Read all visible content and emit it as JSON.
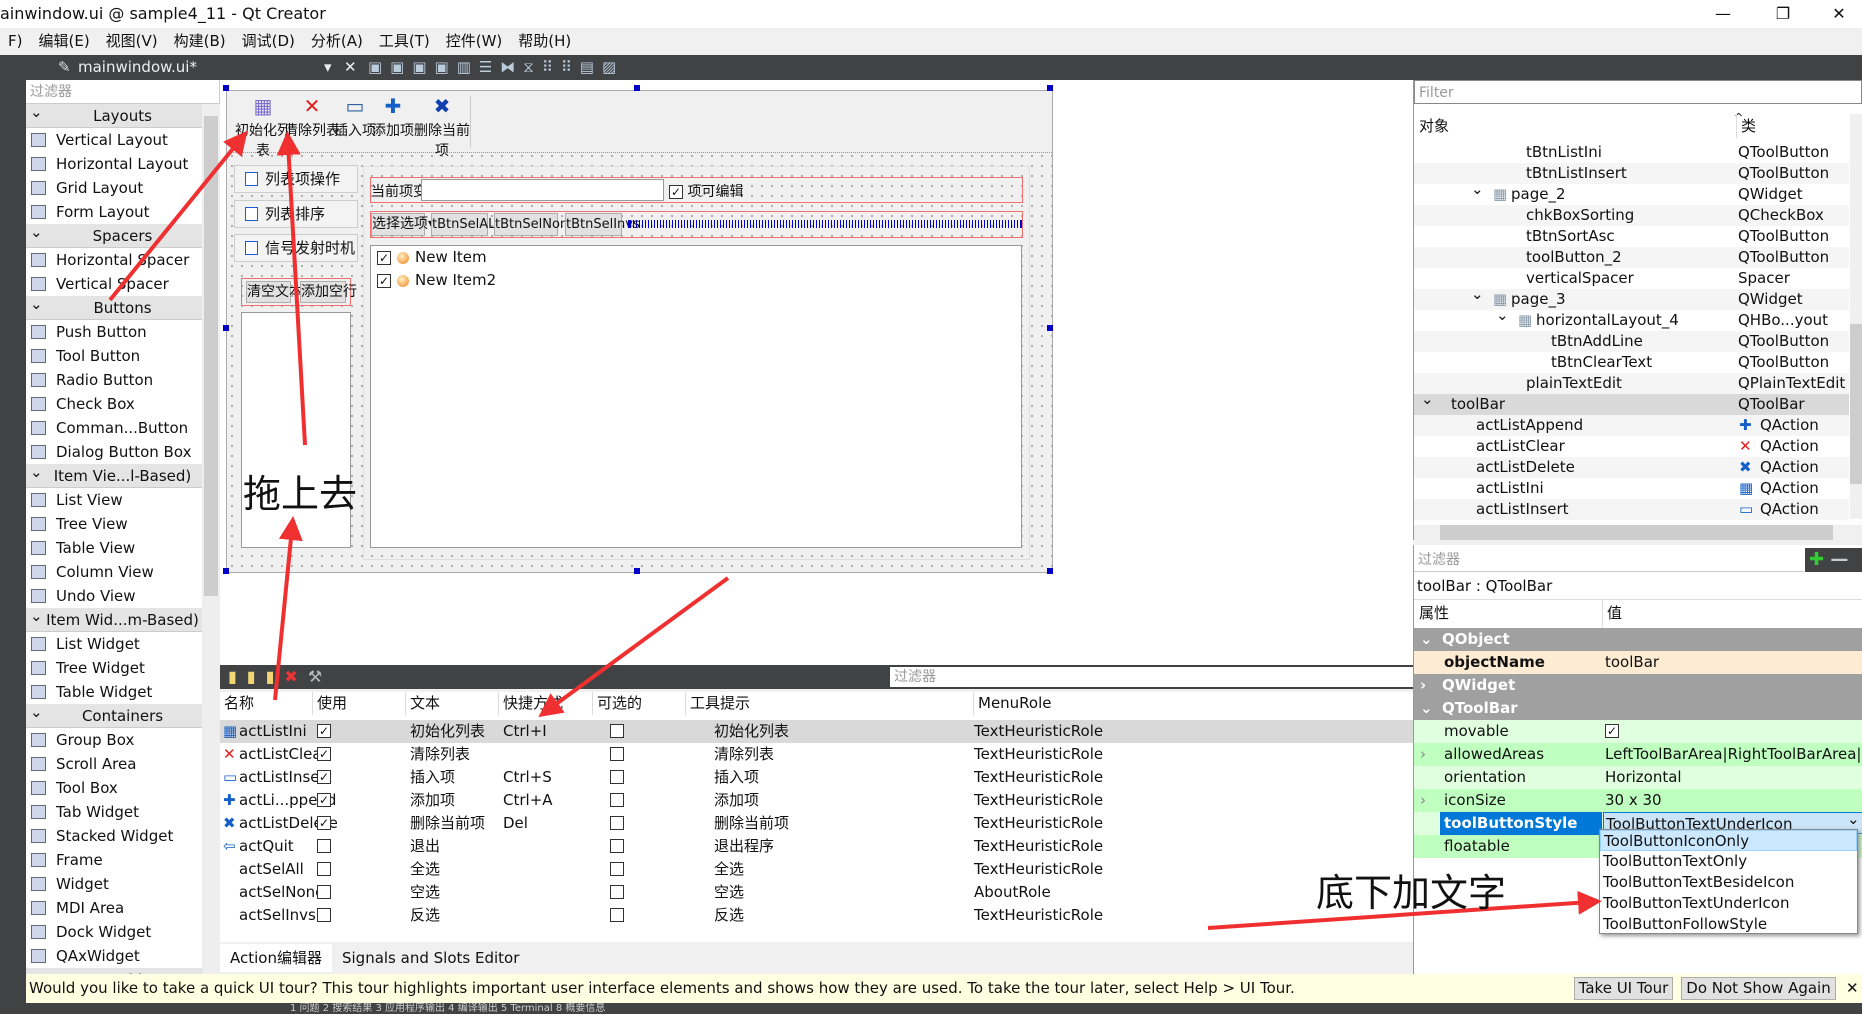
{
  "window": {
    "title": "ainwindow.ui @ sample4_11 - Qt Creator",
    "min": "—",
    "max": "❐",
    "close": "✕"
  },
  "menu": [
    "F)",
    "编辑(E)",
    "视图(V)",
    "构建(B)",
    "调试(D)",
    "分析(A)",
    "工具(T)",
    "控件(W)",
    "帮助(H)"
  ],
  "editor_toolbar": {
    "file": "mainwindow.ui*",
    "close": "✕"
  },
  "widget_box": {
    "filter_placeholder": "过滤器",
    "sections": [
      {
        "title": "Layouts",
        "items": [
          "Vertical Layout",
          "Horizontal Layout",
          "Grid Layout",
          "Form Layout"
        ]
      },
      {
        "title": "Spacers",
        "items": [
          "Horizontal Spacer",
          "Vertical Spacer"
        ]
      },
      {
        "title": "Buttons",
        "items": [
          "Push Button",
          "Tool Button",
          "Radio Button",
          "Check Box",
          "Comman...Button",
          "Dialog Button Box"
        ]
      },
      {
        "title": "Item Vie...l-Based)",
        "items": [
          "List View",
          "Tree View",
          "Table View",
          "Column View",
          "Undo View"
        ]
      },
      {
        "title": "Item Wid...m-Based)",
        "items": [
          "List Widget",
          "Tree Widget",
          "Table Widget"
        ]
      },
      {
        "title": "Containers",
        "items": [
          "Group Box",
          "Scroll Area",
          "Tool Box",
          "Tab Widget",
          "Stacked Widget",
          "Frame",
          "Widget",
          "MDI Area",
          "Dock Widget",
          "QAxWidget"
        ]
      },
      {
        "title": "Input Widgets",
        "items": []
      }
    ]
  },
  "form": {
    "toolbar": [
      {
        "icon": "list-init-icon",
        "glyph": "▦",
        "color": "#7a6fd0",
        "label": "初始化列表"
      },
      {
        "icon": "clear-icon",
        "glyph": "✕",
        "color": "#e02020",
        "label": "清除列表"
      },
      {
        "icon": "insert-icon",
        "glyph": "▭",
        "color": "#3060a0",
        "label": "插入项"
      },
      {
        "icon": "add-icon",
        "glyph": "✚",
        "color": "#1560c8",
        "label": "添加项"
      },
      {
        "icon": "delete-icon",
        "glyph": "✖",
        "color": "#1040b0",
        "label": "删除当前项"
      }
    ],
    "toolbox_pages": [
      "列表项操作",
      "列表排序",
      "信号发射时机"
    ],
    "clear_text": "清空文本",
    "add_line": "添加空行",
    "current_label": "当前项变化",
    "current_value": "",
    "editable_label": "项可编辑",
    "select_button": "选择选项",
    "sel_all": "tBtnSelALL",
    "sel_none": "tBtnSelNone",
    "sel_invs": "tBtnSelInvs",
    "list_items": [
      "New Item",
      "New Item2"
    ]
  },
  "annotations": {
    "drag": "拖上去",
    "text_under": "底下加文字"
  },
  "action_editor": {
    "filter_placeholder": "过滤器",
    "columns": [
      "名称",
      "使用",
      "文本",
      "快捷方式",
      "可选的",
      "工具提示",
      "MenuRole"
    ],
    "rows": [
      {
        "name": "actListIni",
        "icon": "▦",
        "used": true,
        "text": "初始化列表",
        "shortcut": "Ctrl+I",
        "checkable": false,
        "tooltip": "初始化列表",
        "role": "TextHeuristicRole"
      },
      {
        "name": "actListClear",
        "icon": "✕",
        "used": true,
        "text": "清除列表",
        "shortcut": "",
        "checkable": false,
        "tooltip": "清除列表",
        "role": "TextHeuristicRole"
      },
      {
        "name": "actListInsert",
        "icon": "▭",
        "used": true,
        "text": "插入项",
        "shortcut": "Ctrl+S",
        "checkable": false,
        "tooltip": "插入项",
        "role": "TextHeuristicRole"
      },
      {
        "name": "actLi...ppend",
        "icon": "✚",
        "used": true,
        "text": "添加项",
        "shortcut": "Ctrl+A",
        "checkable": false,
        "tooltip": "添加项",
        "role": "TextHeuristicRole"
      },
      {
        "name": "actListDelete",
        "icon": "✖",
        "used": true,
        "text": "删除当前项",
        "shortcut": "Del",
        "checkable": false,
        "tooltip": "删除当前项",
        "role": "TextHeuristicRole"
      },
      {
        "name": "actQuit",
        "icon": "⇦",
        "used": false,
        "text": "退出",
        "shortcut": "",
        "checkable": false,
        "tooltip": "退出程序",
        "role": "TextHeuristicRole"
      },
      {
        "name": "actSelAll",
        "icon": "",
        "used": false,
        "text": "全选",
        "shortcut": "",
        "checkable": false,
        "tooltip": "全选",
        "role": "TextHeuristicRole"
      },
      {
        "name": "actSelNone",
        "icon": "",
        "used": false,
        "text": "空选",
        "shortcut": "",
        "checkable": false,
        "tooltip": "空选",
        "role": "AboutRole"
      },
      {
        "name": "actSelInvs",
        "icon": "",
        "used": false,
        "text": "反选",
        "shortcut": "",
        "checkable": false,
        "tooltip": "反选",
        "role": "TextHeuristicRole"
      }
    ],
    "tabs": [
      "Action编辑器",
      "Signals and Slots Editor"
    ]
  },
  "tour": {
    "message": "Would you like to take a quick UI tour? This tour highlights important user interface elements and shows how they are used. To take the tour later, select Help > UI Tour.",
    "take": "Take UI Tour",
    "dont": "Do Not Show Again",
    "close": "✕"
  },
  "bottom_bar": "1 问题  2 搜索结果  3 应用程序输出  4 编译输出  5 Terminal  8 概要信息",
  "object_inspector": {
    "filter_placeholder": "Filter",
    "col_object": "对象",
    "col_class": "类",
    "rows": [
      {
        "name": "tBtnListIni",
        "cls": "QToolButton",
        "indent": 4
      },
      {
        "name": "tBtnListInsert",
        "cls": "QToolButton",
        "indent": 4
      },
      {
        "name": "page_2",
        "cls": "QWidget",
        "indent": 3,
        "expand": true,
        "grid": true
      },
      {
        "name": "chkBoxSorting",
        "cls": "QCheckBox",
        "indent": 4
      },
      {
        "name": "tBtnSortAsc",
        "cls": "QToolButton",
        "indent": 4
      },
      {
        "name": "toolButton_2",
        "cls": "QToolButton",
        "indent": 4
      },
      {
        "name": "verticalSpacer",
        "cls": "Spacer",
        "indent": 4
      },
      {
        "name": "page_3",
        "cls": "QWidget",
        "indent": 3,
        "expand": true,
        "grid": true
      },
      {
        "name": "horizontalLayout_4",
        "cls": "QHBo...yout",
        "indent": 4,
        "expand": true,
        "grid": true
      },
      {
        "name": "tBtnAddLine",
        "cls": "QToolButton",
        "indent": 5
      },
      {
        "name": "tBtnClearText",
        "cls": "QToolButton",
        "indent": 5
      },
      {
        "name": "plainTextEdit",
        "cls": "QPlainTextEdit",
        "indent": 4
      },
      {
        "name": "toolBar",
        "cls": "QToolBar",
        "indent": 1,
        "expand": true,
        "selected": true
      },
      {
        "name": "actListAppend",
        "cls": "QAction",
        "indent": 2,
        "icon": "✚"
      },
      {
        "name": "actListClear",
        "cls": "QAction",
        "indent": 2,
        "icon": "✕"
      },
      {
        "name": "actListDelete",
        "cls": "QAction",
        "indent": 2,
        "icon": "✖"
      },
      {
        "name": "actListIni",
        "cls": "QAction",
        "indent": 2,
        "icon": "▦"
      },
      {
        "name": "actListInsert",
        "cls": "QAction",
        "indent": 2,
        "icon": "▭"
      }
    ]
  },
  "property_editor": {
    "filter_placeholder": "过滤器",
    "object": "toolBar : QToolBar",
    "col_prop": "属性",
    "col_value": "值",
    "rows": [
      {
        "group": true,
        "name": "QObject"
      },
      {
        "name": "objectName",
        "value": "toolBar",
        "bold": true
      },
      {
        "group": true,
        "name": "QWidget",
        "collapsed": true
      },
      {
        "group": true,
        "name": "QToolBar"
      },
      {
        "name": "movable",
        "value": "✓",
        "check": true
      },
      {
        "name": "allowedAreas",
        "value": "LeftToolBarArea|RightToolBarArea|...",
        "expand": true
      },
      {
        "name": "orientation",
        "value": "Horizontal"
      },
      {
        "name": "iconSize",
        "value": "30 x 30",
        "expand": true
      },
      {
        "name": "toolButtonStyle",
        "value": "ToolButtonTextUnderIcon",
        "selected": true
      },
      {
        "name": "floatable",
        "value": ""
      }
    ],
    "dropdown_options": [
      "ToolButtonIconOnly",
      "ToolButtonTextOnly",
      "ToolButtonTextBesideIcon",
      "ToolButtonTextUnderIcon",
      "ToolButtonFollowStyle"
    ],
    "dropdown_highlight": "ToolButtonIconOnly"
  },
  "colors": {
    "accent": "#0078d7",
    "annotation_arrow": "#f03030",
    "toolbar_group_green": "#bfffbf"
  }
}
